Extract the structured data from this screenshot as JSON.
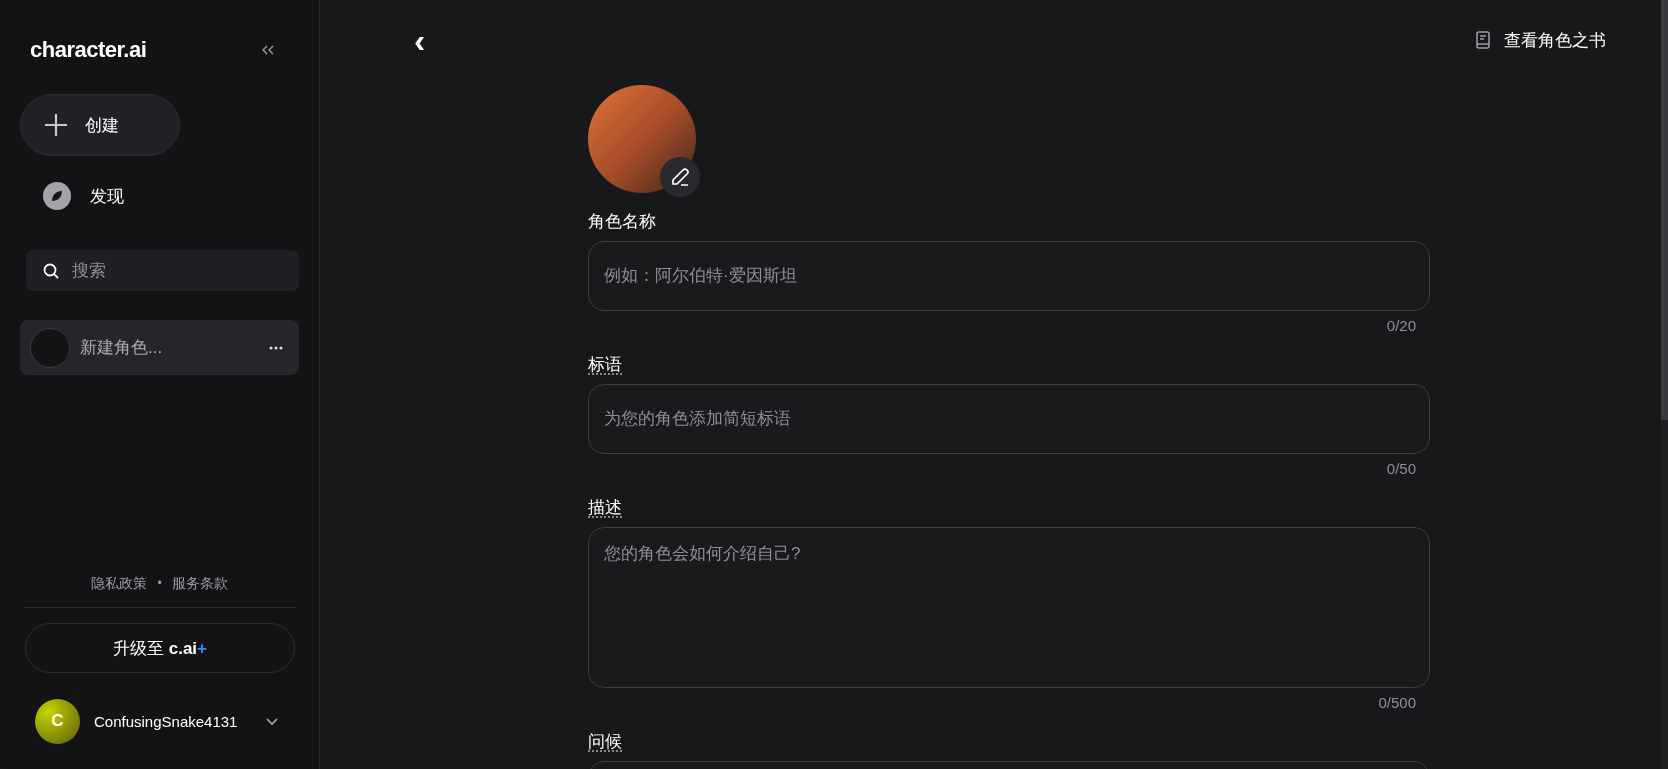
{
  "sidebar": {
    "logo": "character.ai",
    "create_label": "创建",
    "discover_label": "发现",
    "search": {
      "placeholder": "搜索"
    },
    "chats": [
      {
        "name": "新建角色...",
        "selected": true
      }
    ],
    "footer_links": [
      "隐私政策",
      "服务条款"
    ],
    "footer_separator": "•",
    "upgrade": {
      "text": "升级至 ",
      "brand": "c.ai",
      "plus": "+"
    },
    "user": {
      "initial": "C",
      "name": "ConfusingSnake4131"
    }
  },
  "header": {
    "back": "‹",
    "book_link": "查看角色之书"
  },
  "form": {
    "fields": [
      {
        "kind": "input",
        "label": "角色名称",
        "has_tooltip": false,
        "placeholder": "例如：阿尔伯特·爱因斯坦",
        "counter": "0/20"
      },
      {
        "kind": "input",
        "label": "标语",
        "has_tooltip": true,
        "placeholder": "为您的角色添加简短标语",
        "counter": "0/50"
      },
      {
        "kind": "textarea",
        "label": "描述",
        "has_tooltip": true,
        "placeholder": "您的角色会如何介绍自己?",
        "counter": "0/500"
      },
      {
        "kind": "input",
        "label": "问候",
        "has_tooltip": true
      }
    ]
  }
}
